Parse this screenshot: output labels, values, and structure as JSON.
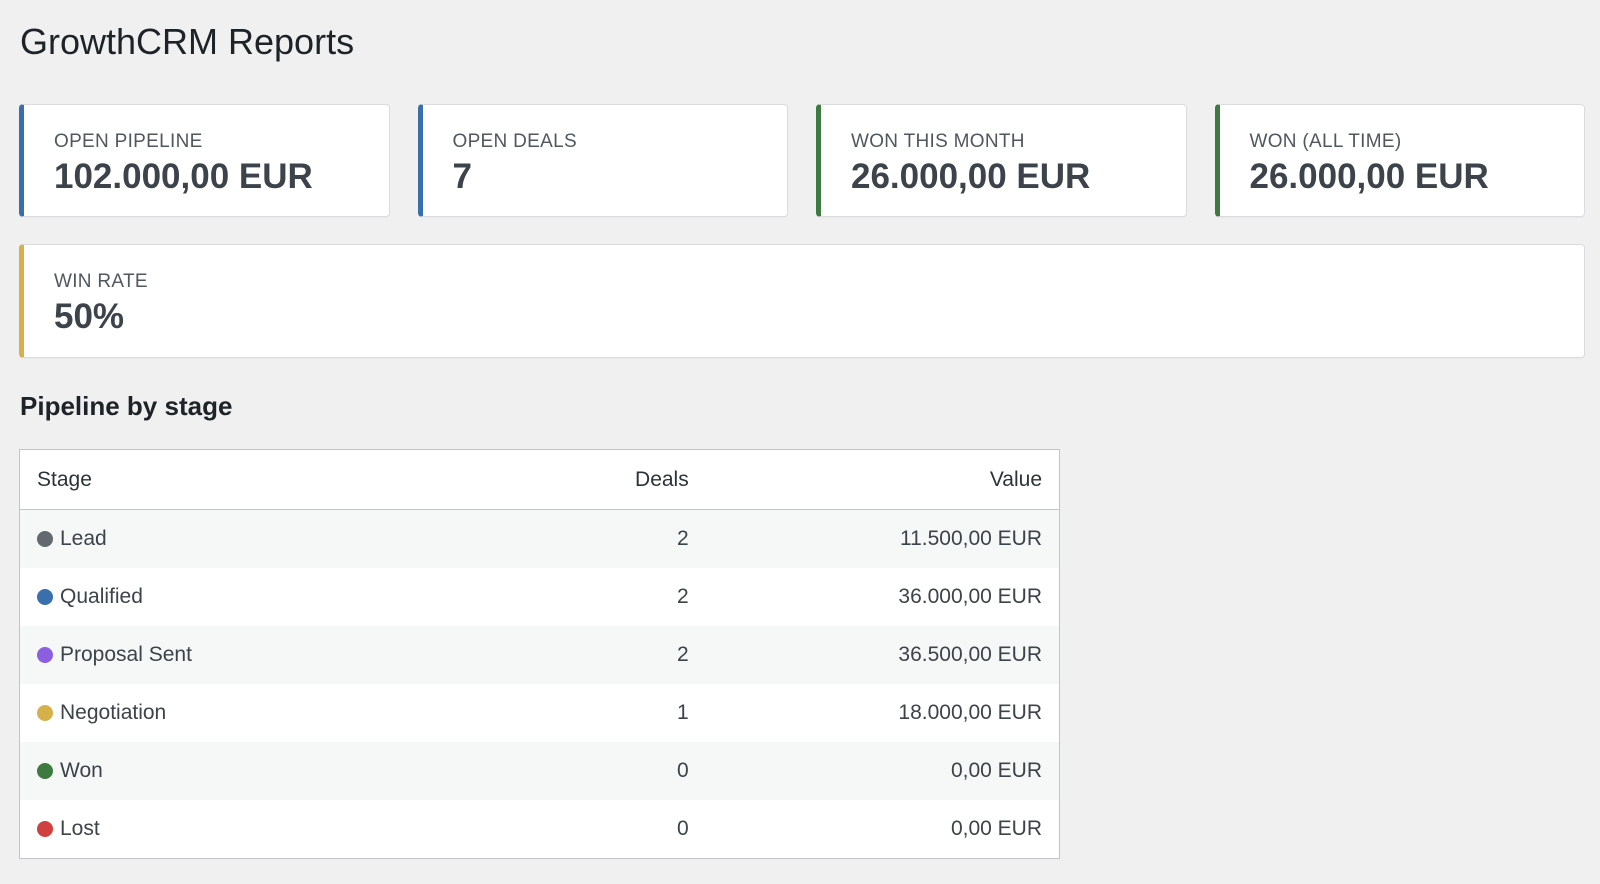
{
  "page": {
    "title": "GrowthCRM Reports"
  },
  "cards": [
    {
      "label": "OPEN PIPELINE",
      "value": "102.000,00 EUR",
      "accent": "#3a6fad"
    },
    {
      "label": "OPEN DEALS",
      "value": "7",
      "accent": "#3a6fad"
    },
    {
      "label": "WON THIS MONTH",
      "value": "26.000,00 EUR",
      "accent": "#3c7a3f"
    },
    {
      "label": "WON (ALL TIME)",
      "value": "26.000,00 EUR",
      "accent": "#3c7a3f"
    }
  ],
  "win_rate": {
    "label": "WIN RATE",
    "value": "50%",
    "accent": "#d6b04b"
  },
  "pipeline": {
    "title": "Pipeline by stage",
    "headers": {
      "stage": "Stage",
      "deals": "Deals",
      "value": "Value"
    },
    "rows": [
      {
        "stage": "Lead",
        "deals": "2",
        "value": "11.500,00 EUR",
        "color": "#646970"
      },
      {
        "stage": "Qualified",
        "deals": "2",
        "value": "36.000,00 EUR",
        "color": "#3a6fad"
      },
      {
        "stage": "Proposal Sent",
        "deals": "2",
        "value": "36.500,00 EUR",
        "color": "#8c5fe0"
      },
      {
        "stage": "Negotiation",
        "deals": "1",
        "value": "18.000,00 EUR",
        "color": "#d6b04b"
      },
      {
        "stage": "Won",
        "deals": "0",
        "value": "0,00 EUR",
        "color": "#3c7a3f"
      },
      {
        "stage": "Lost",
        "deals": "0",
        "value": "0,00 EUR",
        "color": "#d04040"
      }
    ]
  }
}
